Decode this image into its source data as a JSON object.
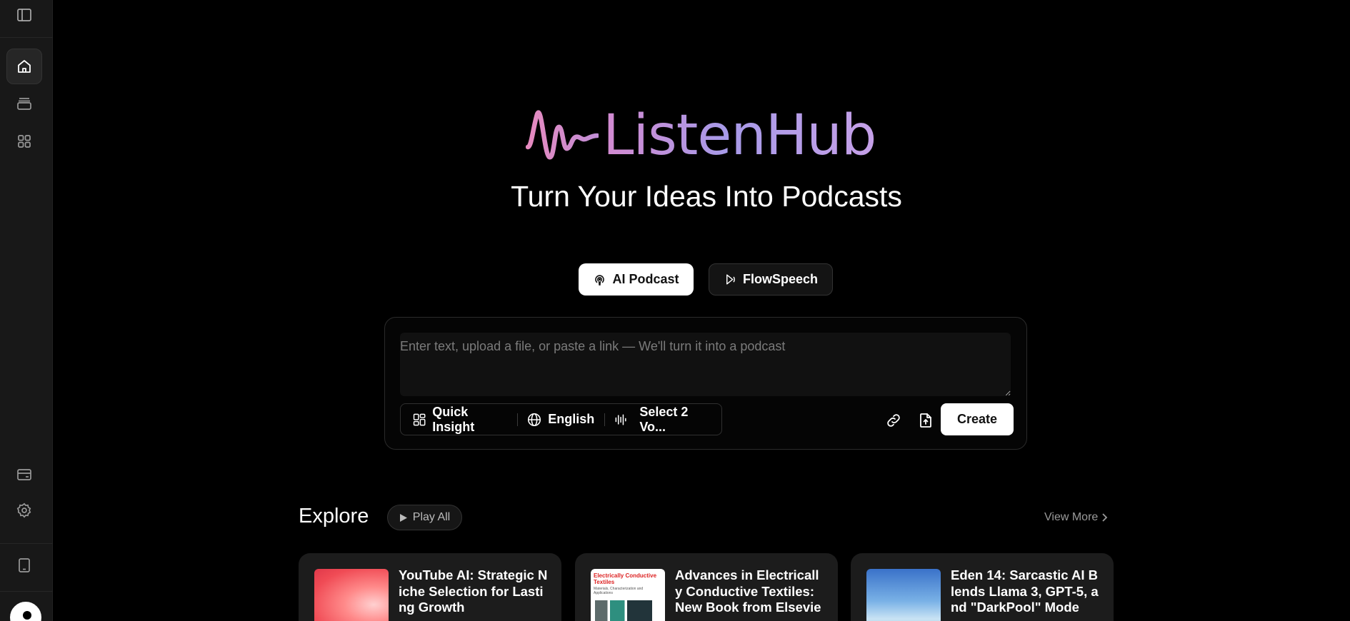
{
  "sidebar": {
    "toggle_icon": "sidebar-toggle-icon",
    "items": [
      {
        "name": "home",
        "icon": "home-icon",
        "active": true
      },
      {
        "name": "library",
        "icon": "stack-icon",
        "active": false
      },
      {
        "name": "apps",
        "icon": "grid-icon",
        "active": false
      }
    ],
    "bottom_items": [
      {
        "name": "billing",
        "icon": "wallet-icon"
      },
      {
        "name": "settings",
        "icon": "gear-icon"
      },
      {
        "name": "mobile",
        "icon": "tablet-icon"
      }
    ]
  },
  "hero": {
    "logo_text": "ListenHub",
    "tagline": "Turn Your Ideas Into Podcasts"
  },
  "modes": {
    "ai_podcast": "AI Podcast",
    "flowspeech": "FlowSpeech",
    "selected": "AI Podcast"
  },
  "composer": {
    "placeholder": "Enter text, upload a file, or paste a link — We'll turn it into a podcast",
    "value": "",
    "mode_option": "Quick Insight",
    "language_option": "English",
    "voice_option": "Select 2 Vo...",
    "create_label": "Create"
  },
  "explore": {
    "title": "Explore",
    "play_all": "Play All",
    "view_more": "View More",
    "cards": [
      {
        "title": "YouTube AI: Strategic Niche Selection for Lasting Growth"
      },
      {
        "title": "Advances in Electrically Conductive Textiles: New Book from Elsevier",
        "cover_title": "Electrically Conductive Textiles",
        "cover_subtitle": "Materials, Characterization and Applications"
      },
      {
        "title": "Eden 14: Sarcastic AI Blends Llama 3, GPT-5, and \"DarkPool\" Mode"
      }
    ]
  },
  "colors": {
    "background": "#000000",
    "sidebar": "#181818",
    "logo_gradient_start": "#e68abf",
    "logo_gradient_end": "#b59ae8",
    "card": "#1c1c1c"
  }
}
